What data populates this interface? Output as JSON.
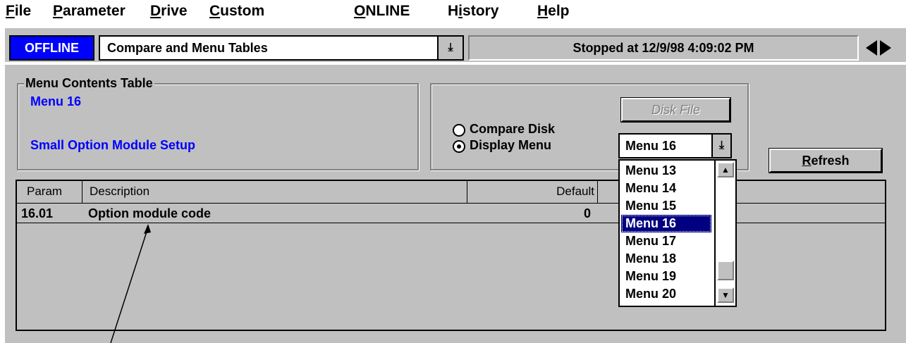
{
  "menubar": {
    "items": [
      {
        "label_first": "F",
        "label_rest": "ile"
      },
      {
        "label_first": "P",
        "label_rest": "arameter"
      },
      {
        "label_first": "D",
        "label_rest": "rive"
      },
      {
        "label_first": "C",
        "label_rest": "ustom"
      },
      {
        "label_first": "O",
        "label_rest": "NLINE"
      },
      {
        "label_first": "Hi",
        "label_rest": "story",
        "underline_index": 1
      },
      {
        "label_first": "H",
        "label_rest": "elp"
      }
    ]
  },
  "toolbar": {
    "mode_badge": "OFFLINE",
    "table_select_value": "Compare and Menu Tables",
    "status_text": "Stopped at 12/9/98 4:09:02 PM"
  },
  "menu_contents": {
    "group_title": "Menu Contents Table",
    "menu_name": "Menu 16",
    "menu_description": "Small Option Module Setup"
  },
  "options": {
    "compare_disk_label": "Compare Disk",
    "display_menu_label": "Display Menu",
    "selected_option": "display_menu",
    "disk_file_button": "Disk File",
    "menu_select_value": "Menu 16",
    "refresh_button_first": "R",
    "refresh_button_rest": "efresh"
  },
  "menu_dropdown": {
    "items": [
      "Menu 13",
      "Menu 14",
      "Menu 15",
      "Menu 16",
      "Menu 17",
      "Menu 18",
      "Menu 19",
      "Menu 20"
    ],
    "selected": "Menu 16"
  },
  "table": {
    "columns": [
      "Param",
      "Description",
      "Default"
    ],
    "rows": [
      {
        "param": "16.01",
        "description": "Option module code",
        "default": "0"
      }
    ]
  },
  "colors": {
    "window_bg": "#c0c0c0",
    "accent_blue": "#0000ff",
    "selection_navy": "#000080"
  }
}
